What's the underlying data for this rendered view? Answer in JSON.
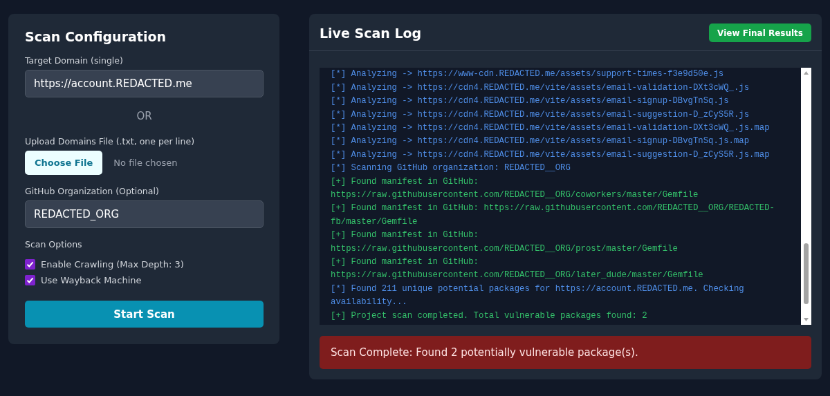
{
  "config": {
    "title": "Scan Configuration",
    "target_domain": {
      "label": "Target Domain (single)",
      "value": "https://account.REDACTED.me"
    },
    "separator": "OR",
    "upload": {
      "label": "Upload Domains File (.txt, one per line)",
      "button": "Choose File",
      "status": "No file chosen"
    },
    "github_org": {
      "label": "GitHub Organization (Optional)",
      "value": "REDACTED_ORG"
    },
    "options_label": "Scan Options",
    "options": [
      {
        "label": "Enable Crawling (Max Depth: 3)",
        "checked": true
      },
      {
        "label": "Use Wayback Machine",
        "checked": true
      }
    ],
    "start_button": "Start Scan"
  },
  "log": {
    "title": "Live Scan Log",
    "results_button": "View Final Results",
    "lines": [
      {
        "kind": "info",
        "text": "[*] Analyzing -> https://www-cdn.REDACTED.me/assets/support-times-f3e9d50e.js"
      },
      {
        "kind": "info",
        "text": "[*] Analyzing -> https://cdn4.REDACTED.me/vite/assets/email-validation-DXt3cWQ_.js"
      },
      {
        "kind": "info",
        "text": "[*] Analyzing -> https://cdn4.REDACTED.me/vite/assets/email-signup-DBvgTnSq.js"
      },
      {
        "kind": "info",
        "text": "[*] Analyzing -> https://cdn4.REDACTED.me/vite/assets/email-suggestion-D_zCyS5R.js"
      },
      {
        "kind": "info",
        "text": "[*] Analyzing -> https://cdn4.REDACTED.me/vite/assets/email-validation-DXt3cWQ_.js.map"
      },
      {
        "kind": "info",
        "text": "[*] Analyzing -> https://cdn4.REDACTED.me/vite/assets/email-signup-DBvgTnSq.js.map"
      },
      {
        "kind": "info",
        "text": "[*] Analyzing -> https://cdn4.REDACTED.me/vite/assets/email-suggestion-D_zCyS5R.js.map"
      },
      {
        "kind": "info",
        "text": "[*] Scanning GitHub organization: REDACTED__ORG"
      },
      {
        "kind": "found",
        "text": "[+] Found manifest in GitHub: https://raw.githubusercontent.com/REDACTED__ORG/coworkers/master/Gemfile"
      },
      {
        "kind": "found",
        "text": "[+] Found manifest in GitHub: https://raw.githubusercontent.com/REDACTED__ORG/REDACTED-fb/master/Gemfile"
      },
      {
        "kind": "found",
        "text": "[+] Found manifest in GitHub: https://raw.githubusercontent.com/REDACTED__ORG/prost/master/Gemfile"
      },
      {
        "kind": "found",
        "text": "[+] Found manifest in GitHub: https://raw.githubusercontent.com/REDACTED__ORG/later_dude/master/Gemfile"
      },
      {
        "kind": "info",
        "text": "[*] Found 211 unique potential packages for https://account.REDACTED.me. Checking availability..."
      },
      {
        "kind": "found",
        "text": "[+] Project scan completed. Total vulnerable packages found: 2"
      }
    ],
    "alert": "Scan Complete: Found 2 potentially vulnerable package(s)."
  }
}
